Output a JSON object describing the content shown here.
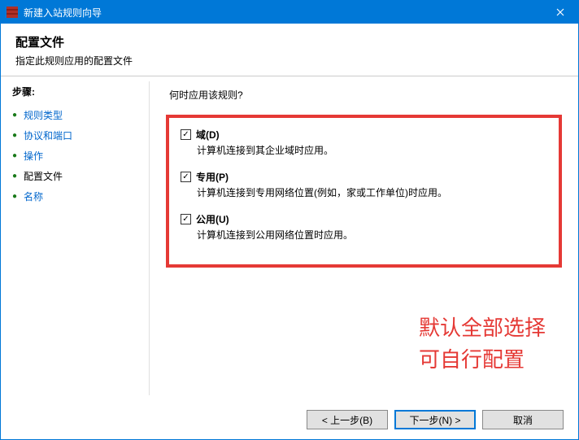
{
  "titlebar": {
    "text": "新建入站规则向导"
  },
  "header": {
    "title": "配置文件",
    "subtitle": "指定此规则应用的配置文件"
  },
  "sidebar": {
    "heading": "步骤:",
    "steps": [
      {
        "label": "规则类型",
        "current": false
      },
      {
        "label": "协议和端口",
        "current": false
      },
      {
        "label": "操作",
        "current": false
      },
      {
        "label": "配置文件",
        "current": true
      },
      {
        "label": "名称",
        "current": false
      }
    ]
  },
  "content": {
    "prompt": "何时应用该规则?",
    "options": [
      {
        "label": "域(D)",
        "desc": "计算机连接到其企业域时应用。",
        "checked": true
      },
      {
        "label": "专用(P)",
        "desc": "计算机连接到专用网络位置(例如，家或工作单位)时应用。",
        "checked": true
      },
      {
        "label": "公用(U)",
        "desc": "计算机连接到公用网络位置时应用。",
        "checked": true
      }
    ],
    "annotation_line1": "默认全部选择",
    "annotation_line2": "可自行配置"
  },
  "footer": {
    "back": "< 上一步(B)",
    "next": "下一步(N) >",
    "cancel": "取消"
  },
  "checkmark": "✓",
  "bullet": "●"
}
